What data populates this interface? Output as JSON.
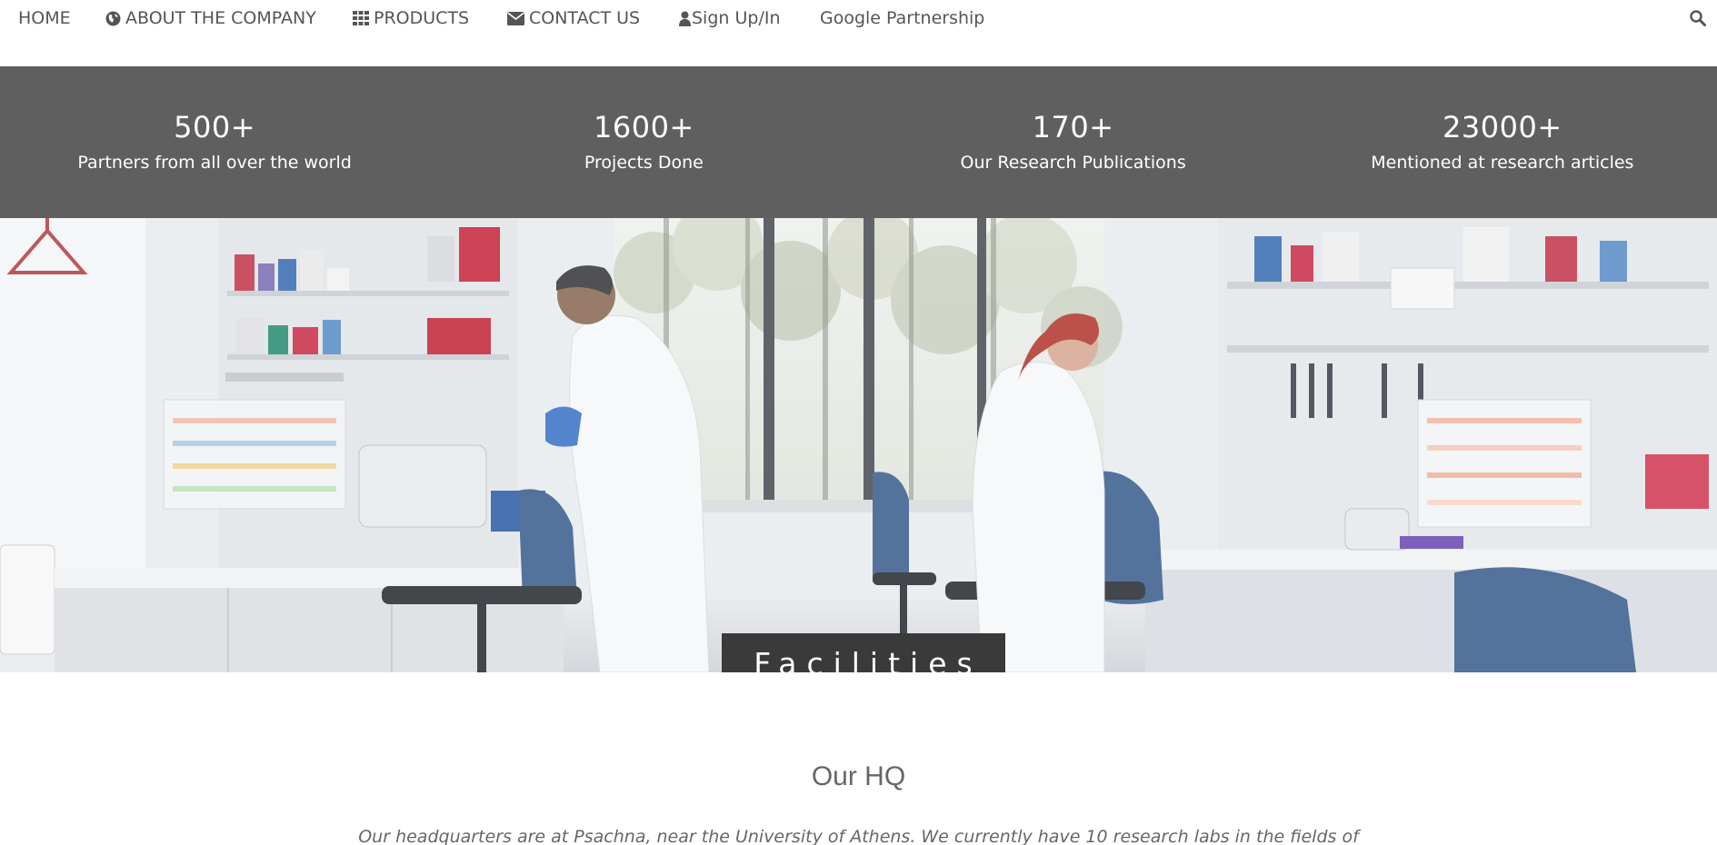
{
  "nav": {
    "home": "HOME",
    "about": "ABOUT THE COMPANY",
    "products": "PRODUCTS",
    "contact": "CONTACT US",
    "signup": "Sign Up/In",
    "google": "Google Partnership",
    "icons": {
      "about": "globe-icon",
      "products": "grid-icon",
      "contact": "envelope-icon",
      "signup": "user-icon",
      "search": "search-icon"
    }
  },
  "stats": [
    {
      "value": "500+",
      "label": "Partners from all over the world"
    },
    {
      "value": "1600+",
      "label": "Projects Done"
    },
    {
      "value": "170+",
      "label": "Our Research Publications"
    },
    {
      "value": "23000+",
      "label": "Mentioned at research articles"
    }
  ],
  "hero": {
    "badge": "Facilities"
  },
  "hq": {
    "title": "Our HQ",
    "text": "Our headquarters are at Psachna, near the University of Athens. We currently have 10 research labs in the fields of"
  },
  "colors": {
    "stats_bg": "#5f5f5f",
    "badge_bg": "#3a3a3a",
    "nav_text": "#555555"
  }
}
